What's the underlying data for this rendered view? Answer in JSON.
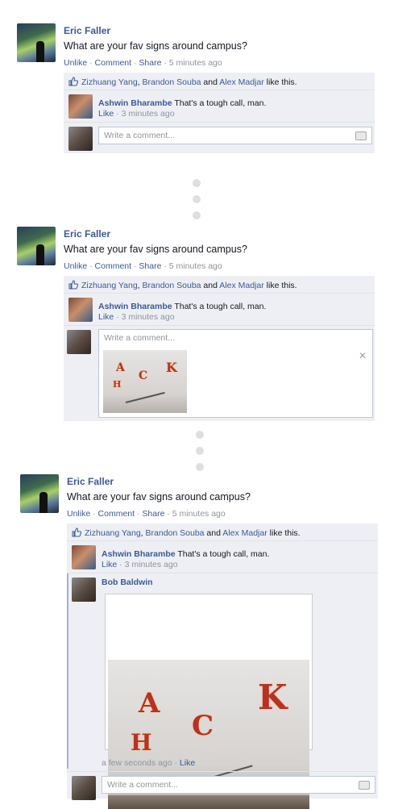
{
  "post": {
    "author": "Eric Faller",
    "text": "What are your fav signs around campus?",
    "actions": {
      "unlike": "Unlike",
      "comment": "Comment",
      "share": "Share",
      "sep": " · ",
      "time": "5 minutes ago"
    }
  },
  "likes": {
    "person1": "Zizhuang Yang",
    "comma": ", ",
    "person2": "Brandon Souba",
    "and": " and ",
    "person3": "Alex Madjar",
    "suffix": " like this."
  },
  "comment1": {
    "author": "Ashwin Bharambe",
    "text": " That's a tough call, man.",
    "like": "Like",
    "sep": " · ",
    "time": "3 minutes ago"
  },
  "composer": {
    "placeholder": "Write a comment..."
  },
  "comment2": {
    "author": "Bob Baldwin",
    "time": "a few seconds ago",
    "sep": " · ",
    "like": "Like"
  },
  "photo": {
    "letters": [
      "A",
      "C",
      "K",
      "H"
    ]
  }
}
